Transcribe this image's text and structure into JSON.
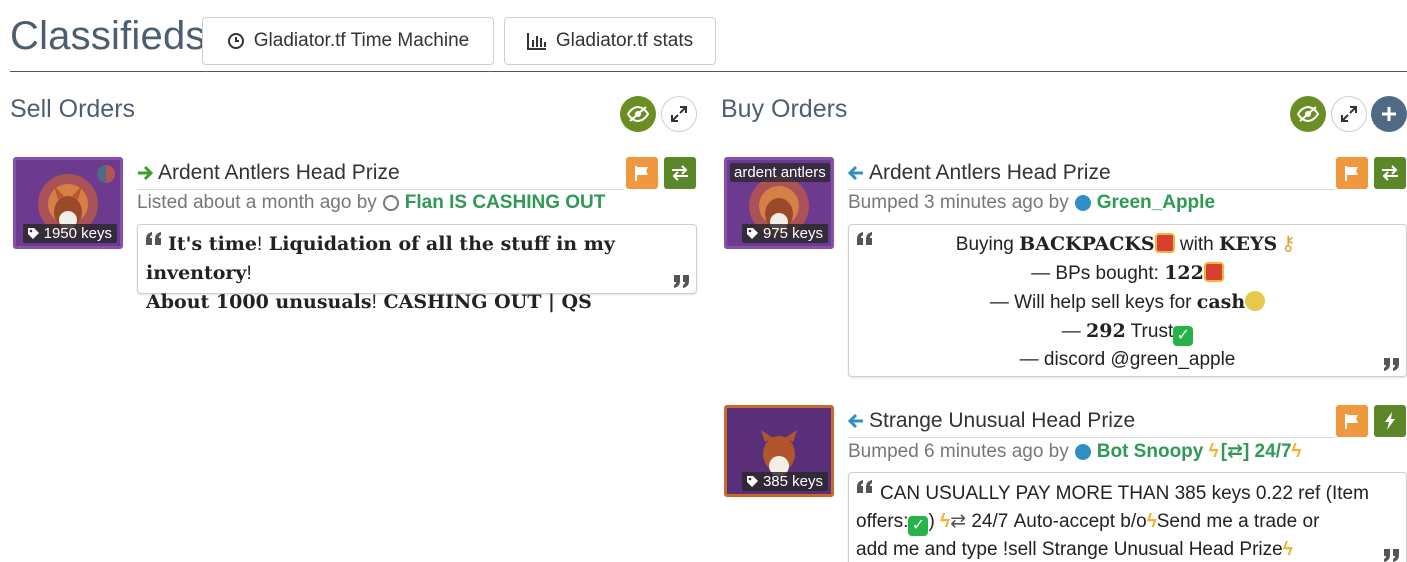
{
  "header": {
    "title": "Classifieds",
    "buttons": [
      {
        "label": "Gladiator.tf Time Machine",
        "icon": "clock-icon"
      },
      {
        "label": "Gladiator.tf stats",
        "icon": "bar-chart-icon"
      }
    ]
  },
  "sell": {
    "title": "Sell Orders",
    "listings": [
      {
        "item_name": "Ardent Antlers Head Prize",
        "price": "1950 keys",
        "meta_prefix": "Listed about a month ago by",
        "user": "Flan IS CASHING OUT",
        "comment_lines": [
          {
            "a": "It's time",
            "b": "!",
            "c": " Liquidation of all the stuff in my inventory",
            "d": "!"
          },
          {
            "a": "About 1000 unusuals",
            "b": "!",
            "c": " CASHING OUT | QS",
            "d": ""
          }
        ]
      }
    ]
  },
  "buy": {
    "title": "Buy Orders",
    "listings": [
      {
        "item_name": "Ardent Antlers Head Prize",
        "thumb_caption": "ardent antlers",
        "price": "975 keys",
        "meta_prefix": "Bumped 3 minutes ago by",
        "user": "Green_Apple",
        "comment": {
          "l1a": "Buying ",
          "l1b": "BACKPACKS",
          "l1c": " with ",
          "l1d": "KEYS",
          "l2a": "— BPs bought: ",
          "l2b": "122",
          "l3a": "— Will help sell keys for ",
          "l3b": "cash",
          "l4a": "— ",
          "l4b": "292",
          "l4c": " Trust",
          "l5": "— discord @green_apple"
        }
      },
      {
        "item_name": "Strange Unusual Head Prize",
        "price": "385 keys",
        "meta_prefix": "Bumped 6 minutes ago by",
        "user": "Bot Snoopy",
        "user_suffix": "[⇄] 24/7",
        "comment": {
          "l1": "CAN USUALLY PAY MORE THAN 385 keys 0.22 ref (Item",
          "l2a": "offers:",
          "l2b": ") ",
          "l2c": " 24/7 Auto-accept b/o",
          "l2d": "Send me a trade or",
          "l3": "add me and type !sell Strange Unusual Head Prize"
        }
      }
    ]
  },
  "colors": {
    "title": "#4c5f70",
    "user": "#2f9a55",
    "flag": "#f0983e",
    "trade": "#5a8728",
    "eye": "#6a8e23"
  }
}
